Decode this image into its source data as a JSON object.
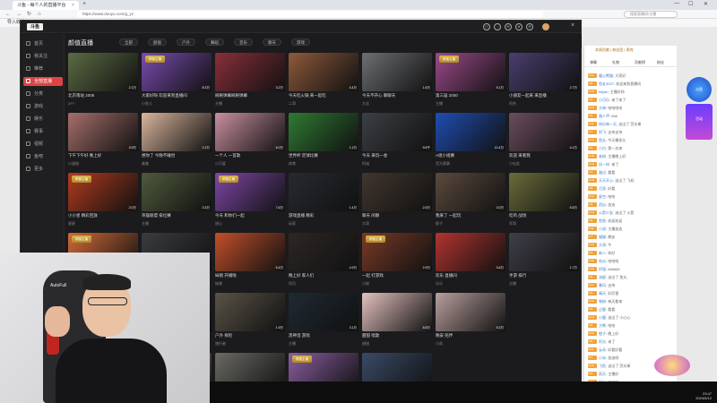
{
  "browser": {
    "tab_title": "斗鱼 - 每个人的直播平台",
    "tab_close": "×",
    "new_tab": "+",
    "url": "https://www.douyu.com/g_yz",
    "search_placeholder": "搜索直播间/主播",
    "bookmarks": "导入收藏"
  },
  "app": {
    "logo": "斗鱼",
    "close": "×",
    "nav": [
      {
        "label": "首页"
      },
      {
        "label": "我关注"
      },
      {
        "label": "推荐"
      },
      {
        "label": "全部直播"
      },
      {
        "label": "分类"
      },
      {
        "label": "游戏"
      },
      {
        "label": "娱乐"
      },
      {
        "label": "赛事"
      },
      {
        "label": "视频"
      },
      {
        "label": "鱼吧"
      },
      {
        "label": "更多"
      }
    ],
    "nav_active_index": 3,
    "section_title": "颜值直播",
    "filters": [
      "全部",
      "颜值",
      "户外",
      "舞蹈",
      "音乐",
      "聊天",
      "游戏"
    ]
  },
  "grid": [
    [
      {
        "title": "北京南站 2008",
        "meta": "ZFY",
        "viewers": "2.1万",
        "color": "#5b6b43"
      },
      {
        "title": "大家好呀 欢迎来到直播间",
        "meta": "小鱼儿",
        "viewers": "8.3万",
        "color": "#7a4bb0",
        "badge": "颜值主播"
      },
      {
        "title": "刷刷弹幕刷刷弹幕",
        "meta": "主播",
        "viewers": "3.2万",
        "color": "#8a2f3a"
      },
      {
        "title": "今天吃火锅 来一起吃",
        "meta": "二哥",
        "viewers": "4.4万",
        "color": "#8d5a3a"
      },
      {
        "title": "今天不开心 聊聊天",
        "meta": "大志",
        "viewers": "1.6万",
        "color": "#6d6f73"
      },
      {
        "title": "第三届 2000",
        "meta": "主播",
        "viewers": "5.1万",
        "color": "#9c4a8a",
        "badge": "颜值主播"
      },
      {
        "title": "小朋友一起来 来直播",
        "meta": "阿杰",
        "viewers": "2.7万",
        "color": "#4a3e6e"
      }
    ],
    [
      {
        "title": "下午下午好 晚上好",
        "meta": "小甜甜",
        "viewers": "3.9万",
        "color": "#a56f6a"
      },
      {
        "title": "想你了 今晚不睡觉",
        "meta": "美美",
        "viewers": "2.2万",
        "color": "#d9b59d"
      },
      {
        "title": "一个人 一首歌",
        "meta": "小可爱",
        "viewers": "6.0万",
        "color": "#c98fa0"
      },
      {
        "title": "世界杯 足球比赛",
        "meta": "体育",
        "viewers": "1.1万",
        "color": "#2f7a33"
      },
      {
        "title": "今天 来玩一会",
        "meta": "阿诚",
        "viewers": "9.8千",
        "color": "#3c3f44"
      },
      {
        "title": "A组小组赛",
        "meta": "官方赛事",
        "viewers": "12.4万",
        "color": "#1f4db3"
      },
      {
        "title": "欢迎 来看我",
        "meta": "小仙女",
        "viewers": "4.1万",
        "color": "#6b4c5e"
      }
    ],
    [
      {
        "title": "小小星 精彩回放",
        "meta": "星星",
        "viewers": "2.0万",
        "color": "#b23b1f",
        "badge": "颜值主播"
      },
      {
        "title": "英雄联盟 排位赛",
        "meta": "主播",
        "viewers": "3.3万",
        "color": "#4e5a3c"
      },
      {
        "title": "今天 和你们一起",
        "meta": "甜心",
        "viewers": "7.6万",
        "color": "#7e47a6",
        "badge": "颜值主播"
      },
      {
        "title": "游戏直播 精彩",
        "meta": "玩家",
        "viewers": "1.4万",
        "color": "#262a30"
      },
      {
        "title": "聊天 闲聊",
        "meta": "大哥",
        "viewers": "2.5万",
        "color": "#42362f"
      },
      {
        "title": "我来了 一起玩",
        "meta": "胖子",
        "viewers": "3.0万",
        "color": "#5b4a3d"
      },
      {
        "title": "吃鸡 战场",
        "meta": "军哥",
        "viewers": "5.5万",
        "color": "#6a6b3a"
      }
    ],
    [
      {
        "title": "颜值主播 回来了",
        "meta": "小美",
        "viewers": "1.8万",
        "color": "#d26a39",
        "badge": "颜值主播"
      },
      {
        "title": "游戏 排位",
        "meta": "阿龙",
        "viewers": "1.2万",
        "color": "#3a3c40"
      },
      {
        "title": "妹猪 开播啦",
        "meta": "妹猪",
        "viewers": "6.4万",
        "color": "#c24f2a"
      },
      {
        "title": "晚上好 家人们",
        "meta": "阿月",
        "viewers": "4.9万",
        "color": "#2d2626"
      },
      {
        "title": "一起 打游戏",
        "meta": "小刚",
        "viewers": "2.9万",
        "color": "#7a3a27",
        "badge": "颜值主播"
      },
      {
        "title": "欢乐 直播间",
        "meta": "乐乐",
        "viewers": "3.6万",
        "color": "#b2342f"
      },
      {
        "title": "手游 排行",
        "meta": "主播",
        "viewers": "1.7万",
        "color": "#3f3f48"
      }
    ],
    [
      {
        "title": "足球经理 比赛中",
        "meta": "教练",
        "viewers": "1.3万",
        "color": "#3a6d2f"
      },
      {
        "title": "游戏 实况",
        "meta": "玩家",
        "viewers": "2.4万",
        "color": "#2b2f3a"
      },
      {
        "title": "户外 探险",
        "meta": "旅行者",
        "viewers": "1.9万",
        "color": "#5a5346"
      },
      {
        "title": "黑神话 游戏",
        "meta": "主播",
        "viewers": "3.1万",
        "color": "#1f2a33"
      },
      {
        "title": "甜甜 唱歌",
        "meta": "甜甜",
        "viewers": "8.8万",
        "color": "#e3c2c0"
      },
      {
        "title": "晚安 陪伴",
        "meta": "小雨",
        "viewers": "5.2万",
        "color": "#b89f9d"
      }
    ],
    [
      {
        "title": "10 周年",
        "meta": "官方",
        "viewers": "9.9万",
        "color": "#c21f2f"
      },
      {
        "title": "美女 直播",
        "meta": "小月",
        "viewers": "4.3万",
        "color": "#a7889a"
      },
      {
        "title": "户外 聊天",
        "meta": "阿伟",
        "viewers": "1.5万",
        "color": "#6b6a64"
      },
      {
        "title": "颜值 主播",
        "meta": "小乖",
        "viewers": "3.8万",
        "color": "#8a5ea0",
        "badge": "颜值主播"
      },
      {
        "title": "游戏 打怪",
        "meta": "玩家",
        "viewers": "2.6万",
        "color": "#3a4a66"
      }
    ]
  ],
  "chat": {
    "badges": "本周贡献  |  粉丝团  |  贵宾",
    "tabs": [
      "弹幕",
      "礼物",
      "贡献榜",
      "粉丝"
    ],
    "messages": [
      {
        "level": "LV12",
        "user": "暖心熊猫",
        "text": "大家好"
      },
      {
        "level": "LV8",
        "user": "鱼友3027",
        "text": "欢迎来到直播间"
      },
      {
        "level": "LV15",
        "user": "feijian",
        "text": "主播好帅"
      },
      {
        "level": "LV6",
        "user": "小可乐",
        "text": "来了来了"
      },
      {
        "level": "LV20",
        "user": "大神",
        "text": "哈哈哈哈"
      },
      {
        "level": "LV9",
        "user": "路人甲",
        "text": "666"
      },
      {
        "level": "LV11",
        "user": "快乐每一天",
        "text": "送出了 荧光棒"
      },
      {
        "level": "LV7",
        "user": "阿飞",
        "text": "支持支持"
      },
      {
        "level": "LV13",
        "user": "鱼丸",
        "text": "今天播多久"
      },
      {
        "level": "LV5",
        "user": "小白",
        "text": "第一次来"
      },
      {
        "level": "LV18",
        "user": "老粉",
        "text": "主播晚上好"
      },
      {
        "level": "LV10",
        "user": "风一样",
        "text": "来了"
      },
      {
        "level": "LV4",
        "user": "路过",
        "text": "看看"
      },
      {
        "level": "LV16",
        "user": "天天开心",
        "text": "送出了 飞机"
      },
      {
        "level": "LV8",
        "user": "月亮",
        "text": "好看"
      },
      {
        "level": "LV12",
        "user": "星空",
        "text": "哈哈"
      },
      {
        "level": "LV9",
        "user": "西瓜",
        "text": "加油"
      },
      {
        "level": "LV14",
        "user": "火箭少女",
        "text": "送出了 火箭"
      },
      {
        "level": "LV6",
        "user": "鱼鱼",
        "text": "欢迎欢迎"
      },
      {
        "level": "LV11",
        "user": "小虎",
        "text": "主播加油"
      },
      {
        "level": "LV7",
        "user": "猫猫",
        "text": "晚安"
      },
      {
        "level": "LV19",
        "user": "大哥",
        "text": "牛"
      },
      {
        "level": "LV3",
        "user": "新人",
        "text": "你好"
      },
      {
        "level": "LV10",
        "user": "吃瓜",
        "text": "哈哈哈"
      },
      {
        "level": "LV13",
        "user": "阿强",
        "text": "666666"
      },
      {
        "level": "LV8",
        "user": "流星",
        "text": "送出了 鱼丸"
      },
      {
        "level": "LV17",
        "user": "暴风",
        "text": "支持"
      },
      {
        "level": "LV9",
        "user": "晴天",
        "text": "好厉害"
      },
      {
        "level": "LV12",
        "user": "铁粉",
        "text": "每天都来"
      },
      {
        "level": "LV5",
        "user": "过客",
        "text": "看看"
      },
      {
        "level": "LV14",
        "user": "小鹿",
        "text": "送出了 小心心"
      },
      {
        "level": "LV6",
        "user": "大熊",
        "text": "哈哈"
      },
      {
        "level": "LV10",
        "user": "橙子",
        "text": "晚上好"
      },
      {
        "level": "LV8",
        "user": "阿光",
        "text": "来了"
      },
      {
        "level": "LV11",
        "user": "云朵",
        "text": "好看好看"
      },
      {
        "level": "LV7",
        "user": "小米",
        "text": "加油呀"
      },
      {
        "level": "LV15",
        "user": "飞鱼",
        "text": "送出了 荧光棒"
      },
      {
        "level": "LV9",
        "user": "雨天",
        "text": "主播好"
      },
      {
        "level": "LV12",
        "user": "阳光",
        "text": "哈哈哈"
      }
    ]
  },
  "promo": {
    "a": "斗鱼",
    "b": "活动"
  },
  "cam": {
    "chair_logo": "AutoFull"
  },
  "clock": {
    "time": "23:47",
    "date": "2024/6/12"
  }
}
